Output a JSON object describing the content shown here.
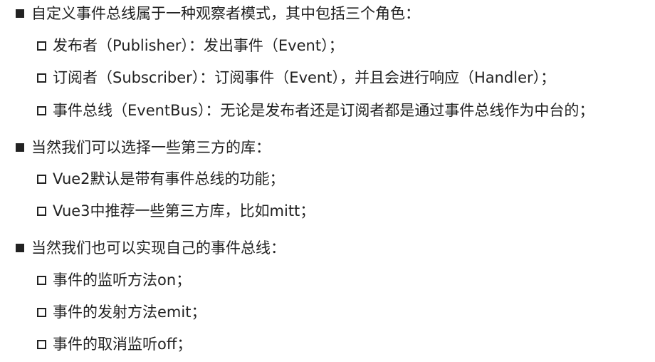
{
  "sections": [
    {
      "label": "自定义事件总线属于一种观察者模式，其中包括三个角色：",
      "items": [
        "发布者（Publisher）：发出事件（Event）；",
        "订阅者（Subscriber）：订阅事件（Event），并且会进行响应（Handler）；",
        "事件总线（EventBus）：无论是发布者还是订阅者都是通过事件总线作为中台的；"
      ]
    },
    {
      "label": "当然我们可以选择一些第三方的库：",
      "items": [
        "Vue2默认是带有事件总线的功能；",
        "Vue3中推荐一些第三方库，比如mitt；"
      ]
    },
    {
      "label": "当然我们也可以实现自己的事件总线：",
      "items": [
        "事件的监听方法on；",
        "事件的发射方法emit；",
        "事件的取消监听off；"
      ]
    }
  ]
}
